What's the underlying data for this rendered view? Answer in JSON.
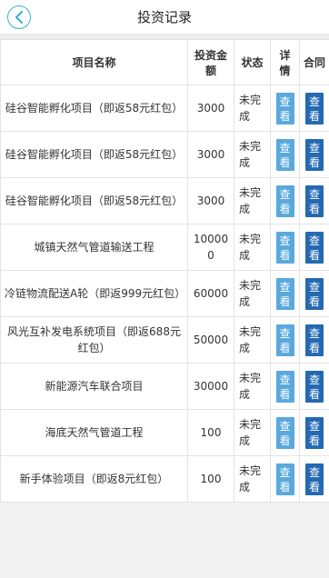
{
  "header": {
    "title": "投资记录",
    "back_icon": "chevron-left-icon"
  },
  "colors": {
    "accent": "#33b0d6",
    "detail_button": "#5aa8dc",
    "contract_button": "#2469b2"
  },
  "table": {
    "headers": {
      "name": "项目名称",
      "amount": "投资金额",
      "status": "状态",
      "detail": "详情",
      "contract": "合同"
    },
    "rows": [
      {
        "name": "硅谷智能孵化项目（即返58元红包）",
        "amount": "3000",
        "status": "未完成",
        "detail": "查看",
        "contract": "查看"
      },
      {
        "name": "硅谷智能孵化项目（即返58元红包）",
        "amount": "3000",
        "status": "未完成",
        "detail": "查看",
        "contract": "查看"
      },
      {
        "name": "硅谷智能孵化项目（即返58元红包）",
        "amount": "3000",
        "status": "未完成",
        "detail": "查看",
        "contract": "查看"
      },
      {
        "name": "城镇天然气管道输送工程",
        "amount": "100000",
        "status": "未完成",
        "detail": "查看",
        "contract": "查看"
      },
      {
        "name": "冷链物流配送A轮（即返999元红包）",
        "amount": "60000",
        "status": "未完成",
        "detail": "查看",
        "contract": "查看"
      },
      {
        "name": "风光互补发电系统项目（即返688元红包）",
        "amount": "50000",
        "status": "未完成",
        "detail": "查看",
        "contract": "查看"
      },
      {
        "name": "新能源汽车联合项目",
        "amount": "30000",
        "status": "未完成",
        "detail": "查看",
        "contract": "查看"
      },
      {
        "name": "海底天然气管道工程",
        "amount": "100",
        "status": "未完成",
        "detail": "查看",
        "contract": "查看"
      },
      {
        "name": "新手体验项目（即返8元红包）",
        "amount": "100",
        "status": "未完成",
        "detail": "查看",
        "contract": "查看"
      }
    ]
  }
}
